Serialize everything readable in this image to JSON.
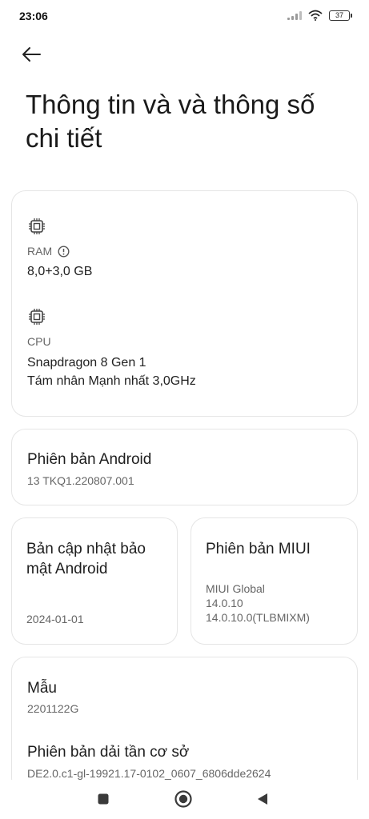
{
  "status_bar": {
    "time": "23:06",
    "battery": "37",
    "icons": [
      "signal-icon",
      "wifi-icon",
      "battery-icon"
    ]
  },
  "header": {
    "back_icon": "arrow-left-icon",
    "title": "Thông tin và và thông số chi tiết"
  },
  "specs": {
    "ram": {
      "label": "RAM",
      "icon": "chip-icon",
      "info_icon": "info-icon",
      "value": "8,0+3,0 GB"
    },
    "cpu": {
      "label": "CPU",
      "icon": "chip-icon",
      "value_line1": "Snapdragon 8 Gen 1",
      "value_line2": "Tám nhân Mạnh nhất 3,0GHz"
    }
  },
  "android_version": {
    "title": "Phiên bản Android",
    "value": "13 TKQ1.220807.001"
  },
  "security_update": {
    "title_line1": "Bản cập nhật bảo",
    "title_line2": "mật Android",
    "value": "2024-01-01"
  },
  "miui_version": {
    "title": "Phiên bản MIUI",
    "value_line1": "MIUI Global",
    "value_line2": "14.0.10",
    "value_line3": "14.0.10.0(TLBMIXM)"
  },
  "model": {
    "title": "Mẫu",
    "value": "2201122G"
  },
  "baseband": {
    "title": "Phiên bản dải tần cơ sở",
    "value": "DE2.0.c1-gl-19921.17-0102_0607_6806dde2624"
  },
  "nav_bar": {
    "icons": [
      "recents-icon",
      "home-icon",
      "back-icon"
    ]
  }
}
